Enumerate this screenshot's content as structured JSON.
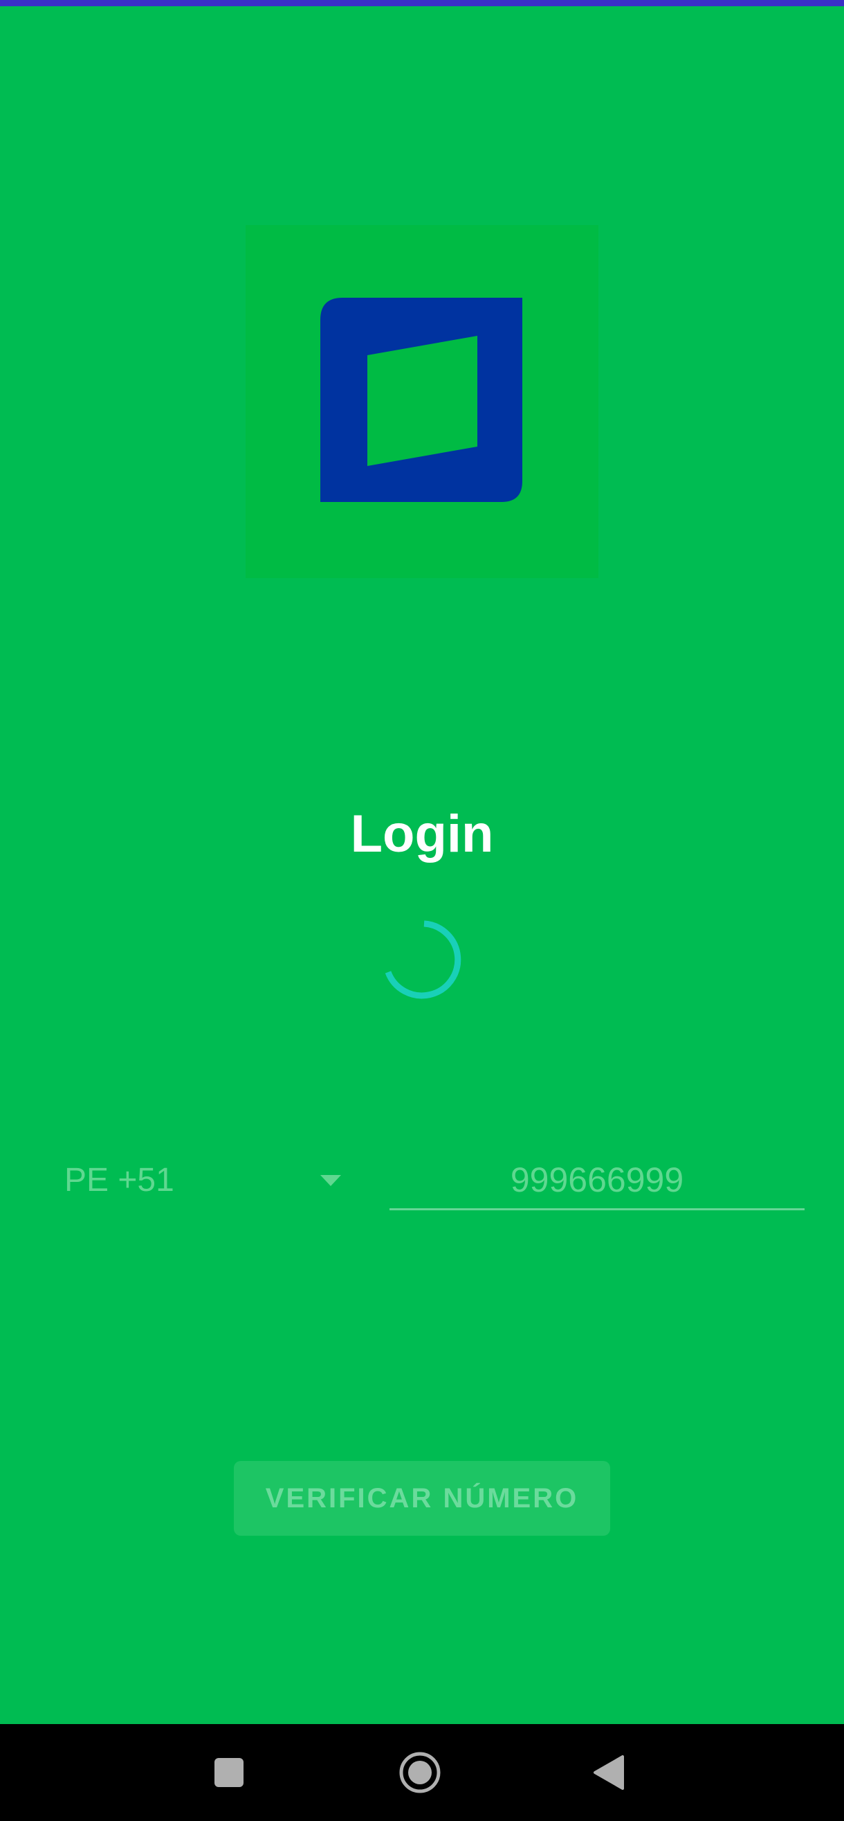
{
  "login": {
    "title": "Login",
    "country_code": "PE +51",
    "phone_placeholder": "999666999",
    "verify_button_label": "VERIFICAR NÚMERO"
  },
  "icons": {
    "logo": "app-logo",
    "spinner": "loading-spinner",
    "chevron": "chevron-down-icon",
    "recents": "recents-icon",
    "home": "home-icon",
    "back": "back-icon"
  },
  "colors": {
    "background": "#00bc52",
    "logo_blue": "#0033a0",
    "spinner": "#19d0b8",
    "status_strip": "#3a2fc6",
    "nav_bar": "#000000"
  }
}
